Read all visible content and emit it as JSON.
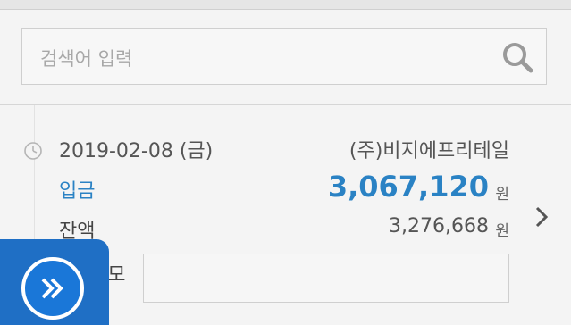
{
  "search": {
    "placeholder": "검색어 입력",
    "icon": "search-icon"
  },
  "transaction": {
    "date": "2019-02-08 (금)",
    "merchant": "(주)비지에프리테일",
    "type_label": "입금",
    "amount": "3,067,120",
    "amount_unit": "원",
    "balance_label": "잔액",
    "balance": "3,276,668",
    "balance_unit": "원",
    "memo_label": "메모",
    "memo_value": ""
  },
  "colors": {
    "accent": "#2a82c4",
    "fab": "#1f6fc5"
  },
  "icons": {
    "clock": "clock-icon",
    "chevron": "chevron-right-icon",
    "fab": "fast-forward-icon"
  }
}
